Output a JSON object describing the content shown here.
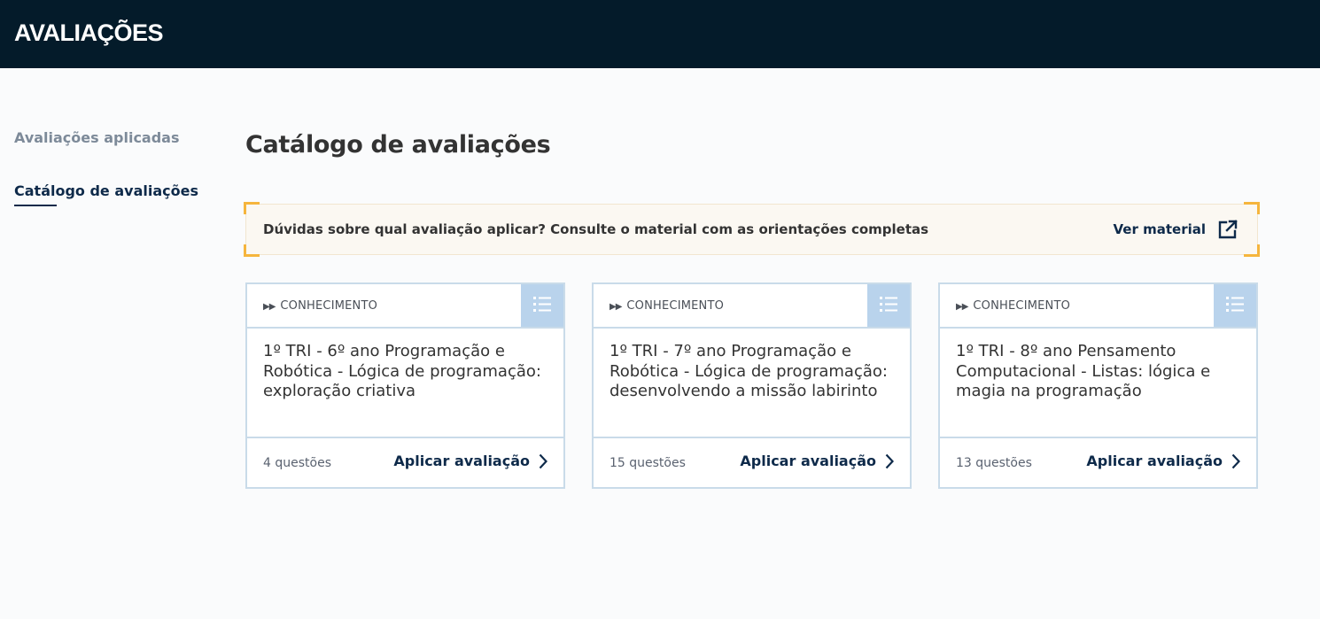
{
  "header": {
    "title": "AVALIAÇÕES"
  },
  "sidebar": {
    "items": [
      {
        "label": "Avaliações aplicadas",
        "active": false
      },
      {
        "label": "Catálogo de avaliações",
        "active": true
      }
    ]
  },
  "main": {
    "title": "Catálogo de avaliações",
    "banner": {
      "text": "Dúvidas sobre qual avaliação aplicar? Consulte o material com as orientações completas",
      "link_label": "Ver material",
      "link_icon": "external-link-icon"
    },
    "cards": [
      {
        "type_label": "CONHECIMENTO",
        "type_icon": "double-play-icon",
        "menu_icon": "list-icon",
        "title": "1º TRI - 6º ano Programação e Robótica - Lógica de programação: exploração criativa",
        "question_count": "4 questões",
        "action_label": "Aplicar avaliação",
        "action_icon": "chevron-right-icon"
      },
      {
        "type_label": "CONHECIMENTO",
        "type_icon": "double-play-icon",
        "menu_icon": "list-icon",
        "title": "1º TRI - 7º ano Programação e Robótica - Lógica de programação: desenvolvendo a missão labirinto",
        "question_count": "15 questões",
        "action_label": "Aplicar avaliação",
        "action_icon": "chevron-right-icon"
      },
      {
        "type_label": "CONHECIMENTO",
        "type_icon": "double-play-icon",
        "menu_icon": "list-icon",
        "title": "1º TRI - 8º ano Pensamento Computacional - Listas: lógica e magia na programação",
        "question_count": "13 questões",
        "action_label": "Aplicar avaliação",
        "action_icon": "chevron-right-icon"
      }
    ]
  },
  "colors": {
    "header_bg": "#041b2a",
    "accent_navy": "#0e2a4a",
    "banner_corner": "#f5b53d",
    "card_border": "#c9dbe9",
    "card_menu_bg": "#b9d3ec"
  }
}
